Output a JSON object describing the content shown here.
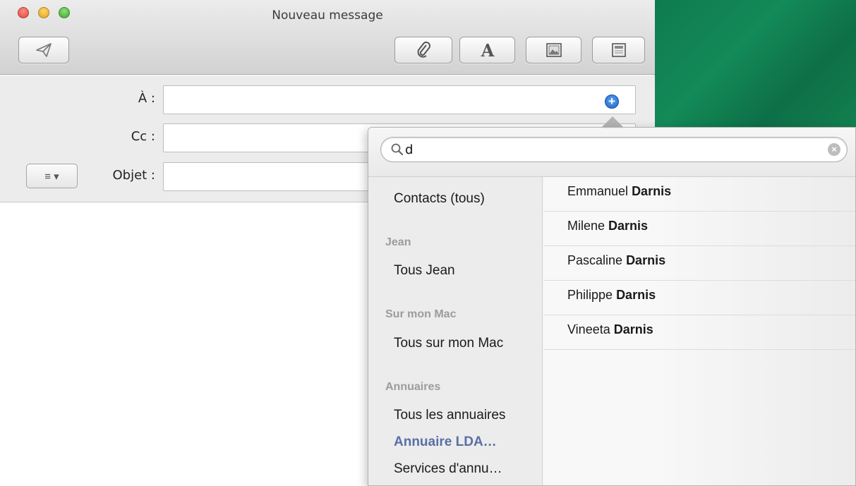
{
  "window": {
    "title": "Nouveau message"
  },
  "toolbar": {
    "send_icon": "paper-plane-icon",
    "attach_icon": "paperclip-icon",
    "format_icon": "font-A-icon",
    "photo_icon": "photo-browser-icon",
    "template_icon": "stationery-icon"
  },
  "fields": {
    "to_label": "À :",
    "cc_label": "Cc :",
    "subject_label": "Objet :",
    "to_value": "",
    "cc_value": "",
    "subject_value": "",
    "format_menu_icon": "≡ ▾"
  },
  "popover": {
    "search_value": "d",
    "sidebar": {
      "all_contacts": "Contacts (tous)",
      "group_jean": "Jean",
      "all_jean": "Tous Jean",
      "group_mac": "Sur mon Mac",
      "all_mac": "Tous sur mon Mac",
      "group_directories": "Annuaires",
      "all_directories": "Tous les annuaires",
      "ldap_directory": "Annuaire LDA…",
      "directory_services": "Services d'annu…"
    },
    "contacts": [
      {
        "first": "Emmanuel",
        "last": "Darnis"
      },
      {
        "first": "Milene",
        "last": "Darnis"
      },
      {
        "first": "Pascaline",
        "last": "Darnis"
      },
      {
        "first": "Philippe",
        "last": "Darnis"
      },
      {
        "first": "Vineeta",
        "last": "Darnis"
      }
    ]
  },
  "colors": {
    "desktop_green": "#0f7a4e",
    "selected_item": "#5a6fa6",
    "add_button_blue": "#1d63c8"
  }
}
